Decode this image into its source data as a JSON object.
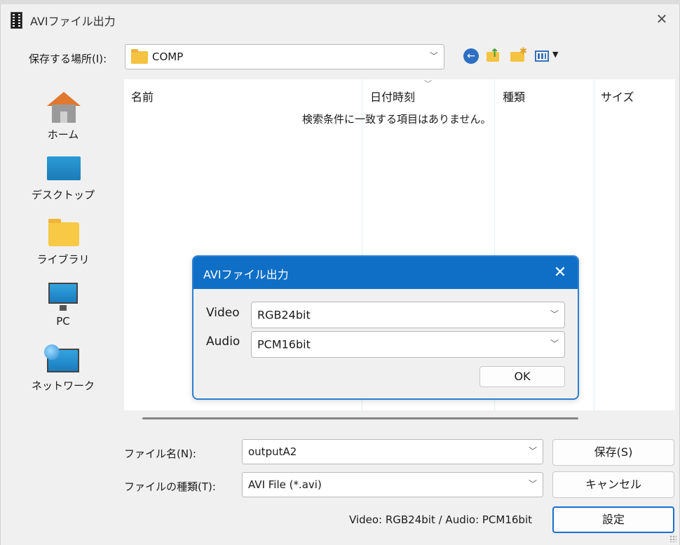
{
  "window": {
    "title": "AVIファイル出力",
    "close_glyph": "✕"
  },
  "location": {
    "label": "保存する場所(I):",
    "value": "COMP"
  },
  "toolbar": {
    "back": "back-icon",
    "up": "up-folder-icon",
    "new_folder": "new-folder-icon",
    "view": "view-menu-icon"
  },
  "places": [
    {
      "label": "ホーム",
      "icon": "home-icon"
    },
    {
      "label": "デスクトップ",
      "icon": "desktop-icon"
    },
    {
      "label": "ライブラリ",
      "icon": "library-icon"
    },
    {
      "label": "PC",
      "icon": "pc-icon"
    },
    {
      "label": "ネットワーク",
      "icon": "network-icon"
    }
  ],
  "list": {
    "columns": [
      "名前",
      "日付時刻",
      "種類",
      "サイズ"
    ],
    "empty_message": "検索条件に一致する項目はありません。"
  },
  "filename": {
    "label": "ファイル名(N):",
    "value": "outputA2"
  },
  "filetype": {
    "label": "ファイルの種類(T):",
    "value": "AVI File (*.avi)"
  },
  "buttons": {
    "save": "保存(S)",
    "cancel": "キャンセル",
    "settings": "設定"
  },
  "status": "Video: RGB24bit / Audio: PCM16bit",
  "dialog": {
    "title": "AVIファイル出力",
    "close_glyph": "✕",
    "video_label": "Video",
    "video_value": "RGB24bit",
    "audio_label": "Audio",
    "audio_value": "PCM16bit",
    "ok": "OK"
  },
  "colors": {
    "accent": "#0f6fc6",
    "dialog_border": "#2b7fd3",
    "background": "#f0f0f0"
  }
}
